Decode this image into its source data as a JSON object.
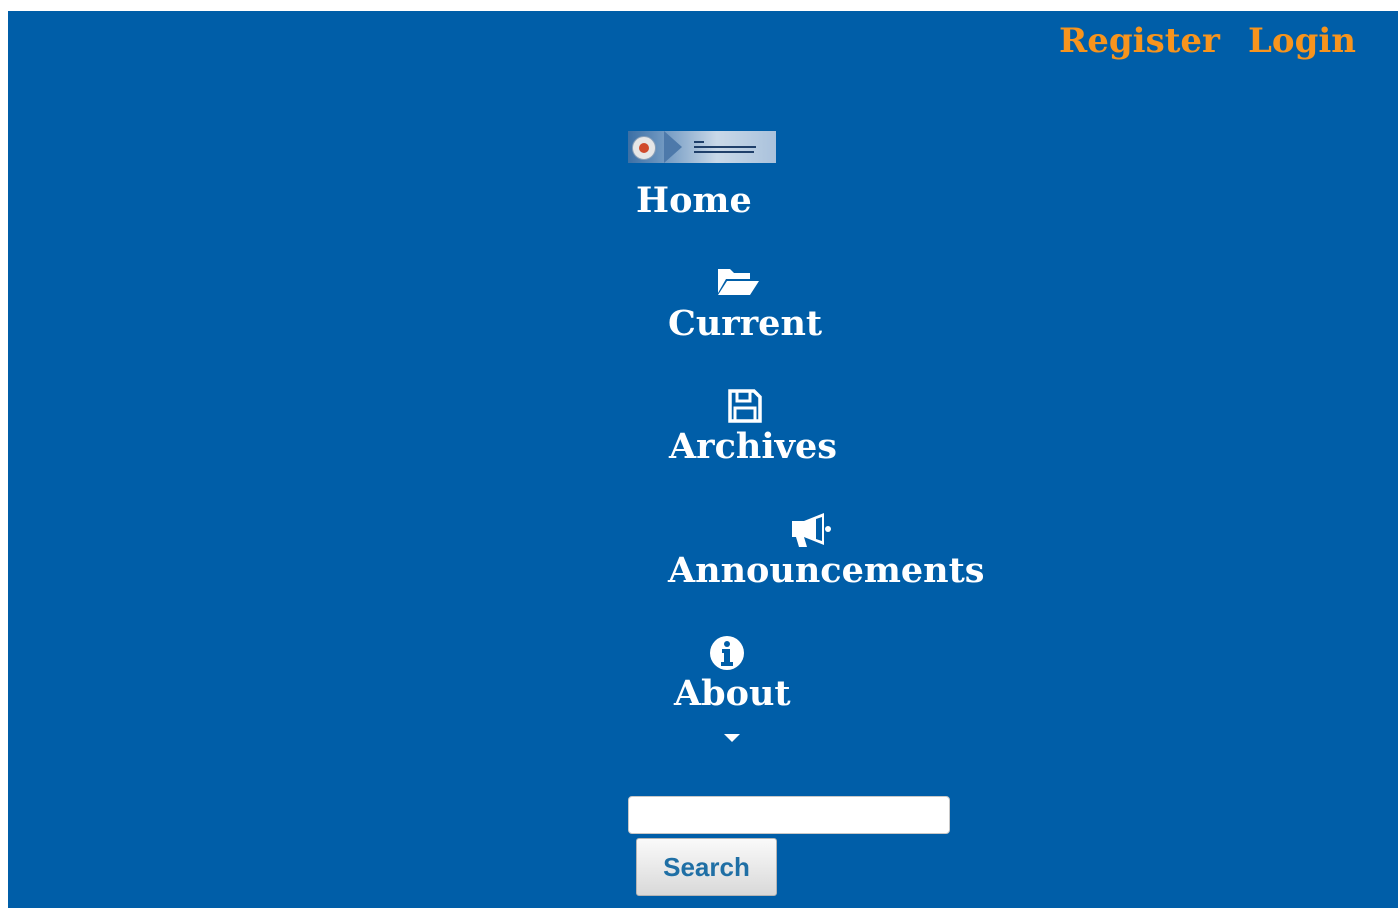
{
  "header": {
    "register_label": "Register",
    "login_label": "Login"
  },
  "nav": {
    "home_label": "Home",
    "current_label": "Current",
    "archives_label": "Archives",
    "announcements_label": "Announcements",
    "about_label": "About"
  },
  "search": {
    "value": "",
    "button_label": "Search"
  },
  "icons": {
    "current": "folder-open-icon",
    "archives": "floppy-disk-icon",
    "announcements": "megaphone-icon",
    "about": "info-circle-icon",
    "about_dropdown": "caret-down-icon"
  },
  "colors": {
    "background": "#005ea8",
    "top_links": "#f7941d",
    "nav_text": "#ffffff"
  }
}
